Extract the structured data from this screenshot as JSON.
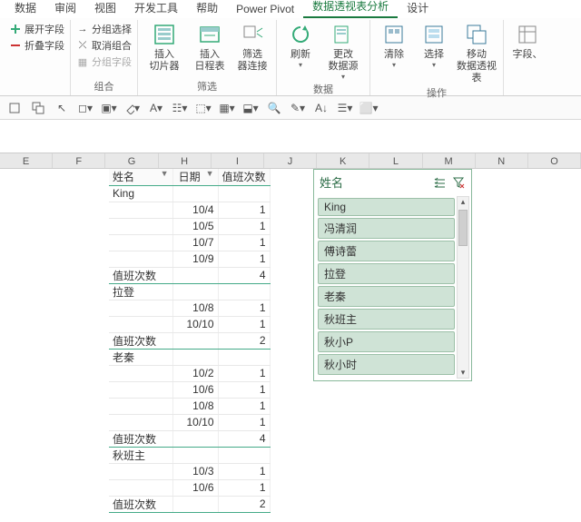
{
  "tabs": {
    "items": [
      {
        "label": "数据"
      },
      {
        "label": "审阅"
      },
      {
        "label": "视图"
      },
      {
        "label": "开发工具"
      },
      {
        "label": "帮助"
      },
      {
        "label": "Power Pivot"
      },
      {
        "label": "数据透视表分析"
      },
      {
        "label": "设计"
      }
    ],
    "active_index": 6
  },
  "ribbon": {
    "group_expand": {
      "expand": "展开字段",
      "collapse": "折叠字段"
    },
    "group_combine": {
      "label": "组合",
      "group_select": "分组选择",
      "ungroup": "取消组合",
      "group_field": "分组字段"
    },
    "group_filter": {
      "label": "筛选",
      "slicer": "插入\n切片器",
      "timeline": "插入\n日程表",
      "filter_conn": "筛选\n器连接"
    },
    "group_data": {
      "label": "数据",
      "refresh": "刷新",
      "change_source": "更改\n数据源"
    },
    "group_ops": {
      "label": "操作",
      "clear": "清除",
      "select": "选择",
      "move": "移动\n数据透视表"
    },
    "group_fields": {
      "fields": "字段、"
    }
  },
  "pivot": {
    "headers": {
      "c1": "姓名",
      "c2": "日期",
      "c3": "值班次数"
    },
    "subtotal_label": "值班次数",
    "rows": [
      {
        "type": "grp",
        "name": "King"
      },
      {
        "type": "d",
        "date": "10/4",
        "v": "1"
      },
      {
        "type": "d",
        "date": "10/5",
        "v": "1"
      },
      {
        "type": "d",
        "date": "10/7",
        "v": "1"
      },
      {
        "type": "d",
        "date": "10/9",
        "v": "1"
      },
      {
        "type": "sub",
        "v": "4"
      },
      {
        "type": "grp",
        "name": "拉登"
      },
      {
        "type": "d",
        "date": "10/8",
        "v": "1"
      },
      {
        "type": "d",
        "date": "10/10",
        "v": "1"
      },
      {
        "type": "sub",
        "v": "2"
      },
      {
        "type": "grp",
        "name": "老秦"
      },
      {
        "type": "d",
        "date": "10/2",
        "v": "1"
      },
      {
        "type": "d",
        "date": "10/6",
        "v": "1"
      },
      {
        "type": "d",
        "date": "10/8",
        "v": "1"
      },
      {
        "type": "d",
        "date": "10/10",
        "v": "1"
      },
      {
        "type": "sub",
        "v": "4"
      },
      {
        "type": "grp",
        "name": "秋班主"
      },
      {
        "type": "d",
        "date": "10/3",
        "v": "1"
      },
      {
        "type": "d",
        "date": "10/6",
        "v": "1"
      },
      {
        "type": "sub",
        "v": "2"
      }
    ]
  },
  "slicer": {
    "title": "姓名",
    "items": [
      "King",
      "冯清润",
      "傅诗蕾",
      "拉登",
      "老秦",
      "秋班主",
      "秋小P",
      "秋小时"
    ]
  },
  "columns": [
    "E",
    "F",
    "G",
    "H",
    "I",
    "J",
    "K",
    "L",
    "M",
    "N",
    "O"
  ]
}
